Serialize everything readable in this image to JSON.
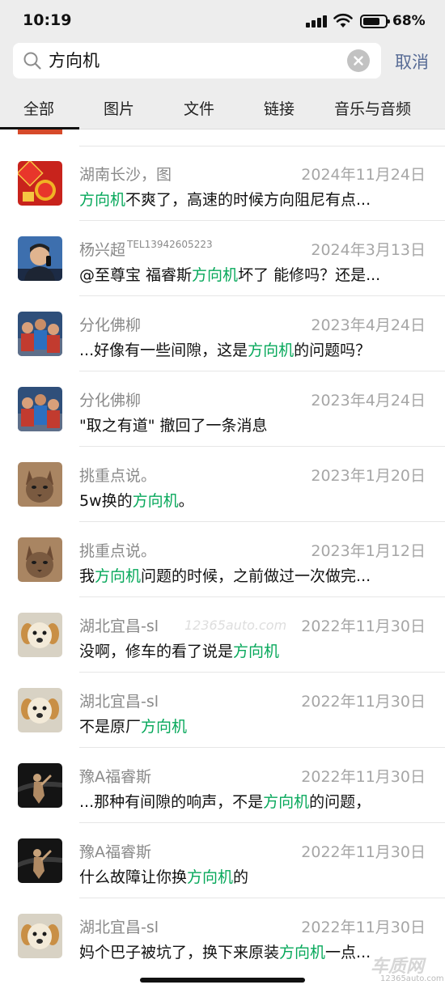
{
  "status_bar": {
    "time": "10:19",
    "battery": "68%"
  },
  "search": {
    "query": "方向机",
    "cancel_label": "取消"
  },
  "tabs": [
    {
      "label": "全部",
      "active": true
    },
    {
      "label": "图片"
    },
    {
      "label": "文件"
    },
    {
      "label": "链接"
    },
    {
      "label": "音乐与音频"
    }
  ],
  "highlight_color": "#07a85b",
  "results": [
    {
      "name": "湖南长沙，图",
      "date": "2024年11月24日",
      "msg_pre": "",
      "msg_hl": "方向机",
      "msg_post": "不爽了，高速的时候方向阻尼有点...",
      "avatar": "fu-red-avatar"
    },
    {
      "name": "杨兴超",
      "name_suffix": "TEL13942605223",
      "date": "2024年3月13日",
      "msg_pre": "@至尊宝 福睿斯",
      "msg_hl": "方向机",
      "msg_post": "坏了 能修吗？还是...",
      "avatar": "man-phone-avatar"
    },
    {
      "name": "分化佛柳",
      "date": "2023年4月24日",
      "msg_pre": "...好像有一些间隙，这是",
      "msg_hl": "方向机",
      "msg_post": "的问题吗？",
      "avatar": "group-kids-avatar"
    },
    {
      "name": "分化佛柳",
      "date": "2023年4月24日",
      "msg_pre": "\"取之有道\" 撤回了一条消息",
      "msg_hl": "",
      "msg_post": "",
      "avatar": "group-kids-avatar"
    },
    {
      "name": "挑重点说。",
      "date": "2023年1月20日",
      "msg_pre": "5w换的",
      "msg_hl": "方向机",
      "msg_post": "。",
      "avatar": "cat-avatar"
    },
    {
      "name": "挑重点说。",
      "date": "2023年1月12日",
      "msg_pre": "我",
      "msg_hl": "方向机",
      "msg_post": "问题的时候，之前做过一次做完...",
      "avatar": "cat-avatar"
    },
    {
      "name": "湖北宜昌-sl",
      "date": "2022年11月30日",
      "msg_pre": "没啊，修车的看了说是",
      "msg_hl": "方向机",
      "msg_post": "",
      "avatar": "puppy-avatar"
    },
    {
      "name": "湖北宜昌-sl",
      "date": "2022年11月30日",
      "msg_pre": "不是原厂",
      "msg_hl": "方向机",
      "msg_post": "",
      "avatar": "puppy-avatar"
    },
    {
      "name": "豫A福睿斯",
      "date": "2022年11月30日",
      "msg_pre": "...那种有间隙的响声，不是",
      "msg_hl": "方向机",
      "msg_post": "的问题，",
      "avatar": "dark-figure-avatar"
    },
    {
      "name": "豫A福睿斯",
      "date": "2022年11月30日",
      "msg_pre": "什么故障让你换",
      "msg_hl": "方向机",
      "msg_post": "的",
      "avatar": "dark-figure-avatar"
    },
    {
      "name": "湖北宜昌-sl",
      "date": "2022年11月30日",
      "msg_pre": "妈个巴子被坑了，换下来原装",
      "msg_hl": "方向机",
      "msg_post": "一点...",
      "avatar": "puppy-avatar"
    }
  ],
  "watermark": {
    "center": "12365auto.com",
    "logo": "车质网",
    "url": "12365auto.com"
  }
}
